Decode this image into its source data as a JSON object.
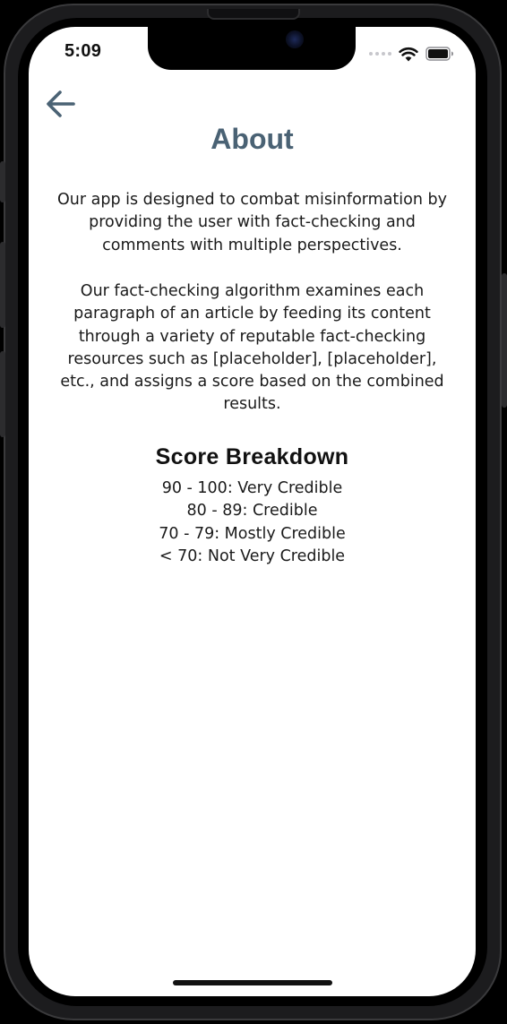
{
  "status_bar": {
    "time": "5:09"
  },
  "header": {
    "back_icon": "arrow-left-icon",
    "title": "About"
  },
  "content": {
    "paragraphs": [
      "Our app is designed to combat misinformation by providing the user with fact-checking and comments with multiple perspectives.",
      "Our fact-checking algorithm examines each paragraph of an article by feeding its content through a variety of reputable fact-checking resources such as [placeholder], [placeholder], etc., and assigns a score based on the combined results."
    ],
    "score_breakdown": {
      "heading": "Score Breakdown",
      "items": [
        "90 - 100: Very Credible",
        "80 - 89: Credible",
        "70 - 79: Mostly Credible",
        "< 70: Not Very Credible"
      ]
    }
  },
  "colors": {
    "title": "#4a6274",
    "back_icon": "#4a6274",
    "body_text": "#1a1a1a",
    "background": "#ffffff"
  }
}
